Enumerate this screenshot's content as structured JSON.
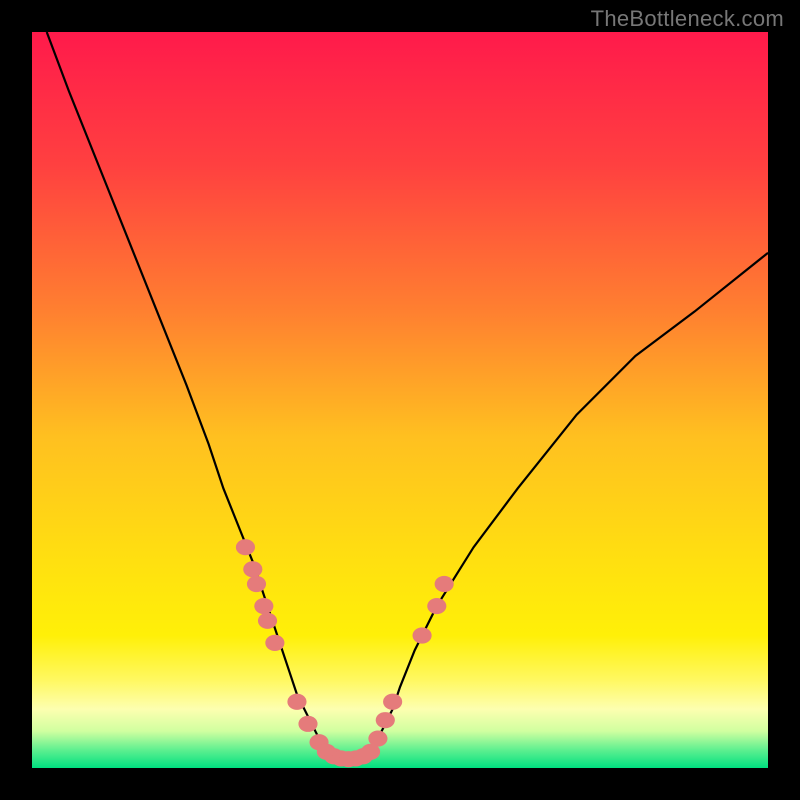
{
  "watermark": "TheBottleneck.com",
  "colors": {
    "frame": "#000000",
    "gradient_stops": [
      {
        "offset": 0.0,
        "color": "#ff1a4b"
      },
      {
        "offset": 0.18,
        "color": "#ff4040"
      },
      {
        "offset": 0.38,
        "color": "#ff8030"
      },
      {
        "offset": 0.55,
        "color": "#ffc020"
      },
      {
        "offset": 0.72,
        "color": "#ffe010"
      },
      {
        "offset": 0.82,
        "color": "#fff008"
      },
      {
        "offset": 0.88,
        "color": "#fff860"
      },
      {
        "offset": 0.92,
        "color": "#fdffb0"
      },
      {
        "offset": 0.95,
        "color": "#d0ffa0"
      },
      {
        "offset": 0.975,
        "color": "#60f090"
      },
      {
        "offset": 1.0,
        "color": "#00e080"
      }
    ],
    "curve": "#000000",
    "dots": "#e57b7b"
  },
  "chart_data": {
    "type": "line",
    "title": "",
    "xlabel": "",
    "ylabel": "",
    "xlim": [
      0,
      100
    ],
    "ylim": [
      0,
      100
    ],
    "grid": false,
    "legend": false,
    "series": [
      {
        "name": "left_curve",
        "x": [
          2,
          5,
          9,
          13,
          17,
          21,
          24,
          26,
          28,
          30,
          31,
          32,
          33,
          34,
          35,
          36,
          37,
          38,
          39,
          40
        ],
        "y": [
          100,
          92,
          82,
          72,
          62,
          52,
          44,
          38,
          33,
          28,
          25,
          22,
          19,
          16,
          13,
          10,
          8,
          6,
          4,
          2
        ]
      },
      {
        "name": "right_curve",
        "x": [
          46,
          47,
          48,
          49,
          50,
          52,
          55,
          60,
          66,
          74,
          82,
          90,
          100
        ],
        "y": [
          2,
          4,
          6,
          8,
          11,
          16,
          22,
          30,
          38,
          48,
          56,
          62,
          70
        ]
      },
      {
        "name": "valley_floor",
        "x": [
          40,
          41,
          42,
          43,
          44,
          45,
          46
        ],
        "y": [
          2,
          1.5,
          1.2,
          1.1,
          1.2,
          1.5,
          2
        ]
      }
    ],
    "scatter": {
      "name": "highlight_dots",
      "points": [
        {
          "x": 29,
          "y": 30
        },
        {
          "x": 30,
          "y": 27
        },
        {
          "x": 30.5,
          "y": 25
        },
        {
          "x": 31.5,
          "y": 22
        },
        {
          "x": 32,
          "y": 20
        },
        {
          "x": 33,
          "y": 17
        },
        {
          "x": 36,
          "y": 9
        },
        {
          "x": 37.5,
          "y": 6
        },
        {
          "x": 39,
          "y": 3.5
        },
        {
          "x": 40,
          "y": 2.2
        },
        {
          "x": 41,
          "y": 1.6
        },
        {
          "x": 42,
          "y": 1.3
        },
        {
          "x": 43,
          "y": 1.2
        },
        {
          "x": 44,
          "y": 1.3
        },
        {
          "x": 45,
          "y": 1.6
        },
        {
          "x": 46,
          "y": 2.2
        },
        {
          "x": 47,
          "y": 4
        },
        {
          "x": 48,
          "y": 6.5
        },
        {
          "x": 49,
          "y": 9
        },
        {
          "x": 53,
          "y": 18
        },
        {
          "x": 55,
          "y": 22
        },
        {
          "x": 56,
          "y": 25
        }
      ]
    }
  }
}
